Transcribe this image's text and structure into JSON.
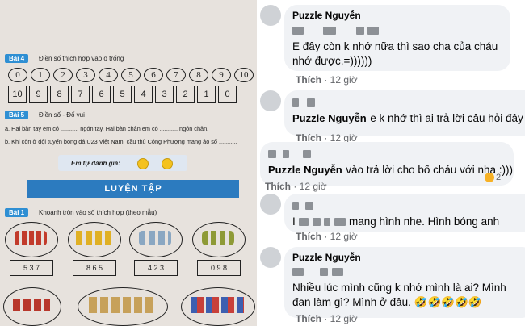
{
  "worksheet": {
    "bai4": {
      "tag": "Bài 4",
      "text": "Điền số thích hợp vào ô trống",
      "row1": [
        "0",
        "1",
        "2",
        "3",
        "4",
        "5",
        "6",
        "7",
        "8",
        "9",
        "10"
      ],
      "row2": [
        "10",
        "9",
        "8",
        "7",
        "6",
        "5",
        "4",
        "3",
        "2",
        "1",
        "0"
      ]
    },
    "bai5": {
      "tag": "Bài 5",
      "text": "Điền số - Đố vui",
      "line_a": "a. Hai bàn tay em có ........... ngón tay. Hai bàn chân em có ........... ngón chân.",
      "line_b": "b. Khi còn ở đội tuyển bóng đá U23 Việt Nam, cầu thủ Công Phượng mang áo số ..........."
    },
    "danh_gia": "Em tự đánh giá:",
    "luyen_tap": "LUYỆN TẬP",
    "bai1": {
      "tag": "Bài 1",
      "text": "Khoanh tròn vào số thích hợp (theo mẫu)",
      "answers": [
        "5 3 7",
        "8 6 5",
        "4 2 3",
        "0 9 8"
      ]
    }
  },
  "comments": [
    {
      "name": "Puzzle Nguyễn",
      "text": "E đây còn k nhớ nữa thì sao cha của cháu nhớ được.=))))))",
      "action": "Thích",
      "time": "12 giờ"
    },
    {
      "name": "Puzzle Nguyễn",
      "text": "e k nhớ thì ai trả lời câu hỏi đây",
      "action": "Thích",
      "time": "12 giờ"
    },
    {
      "name": "Puzzle Nguyễn",
      "text": "vào trả lời cho bố cháu với nha :)))",
      "action": "Thích",
      "time": "12 giờ",
      "reactions": "2"
    },
    {
      "name": "",
      "text": "mang hình nhe. Hình bóng anh",
      "action": "Thích",
      "time": "12 giờ"
    },
    {
      "name": "Puzzle Nguyễn",
      "text": "Nhiều lúc mình cũng k nhớ mình là ai? Mình đan làm gì? Mình ở đâu. 🤣🤣🤣🤣🤣",
      "action": "Thích",
      "time": "12 giờ"
    }
  ]
}
